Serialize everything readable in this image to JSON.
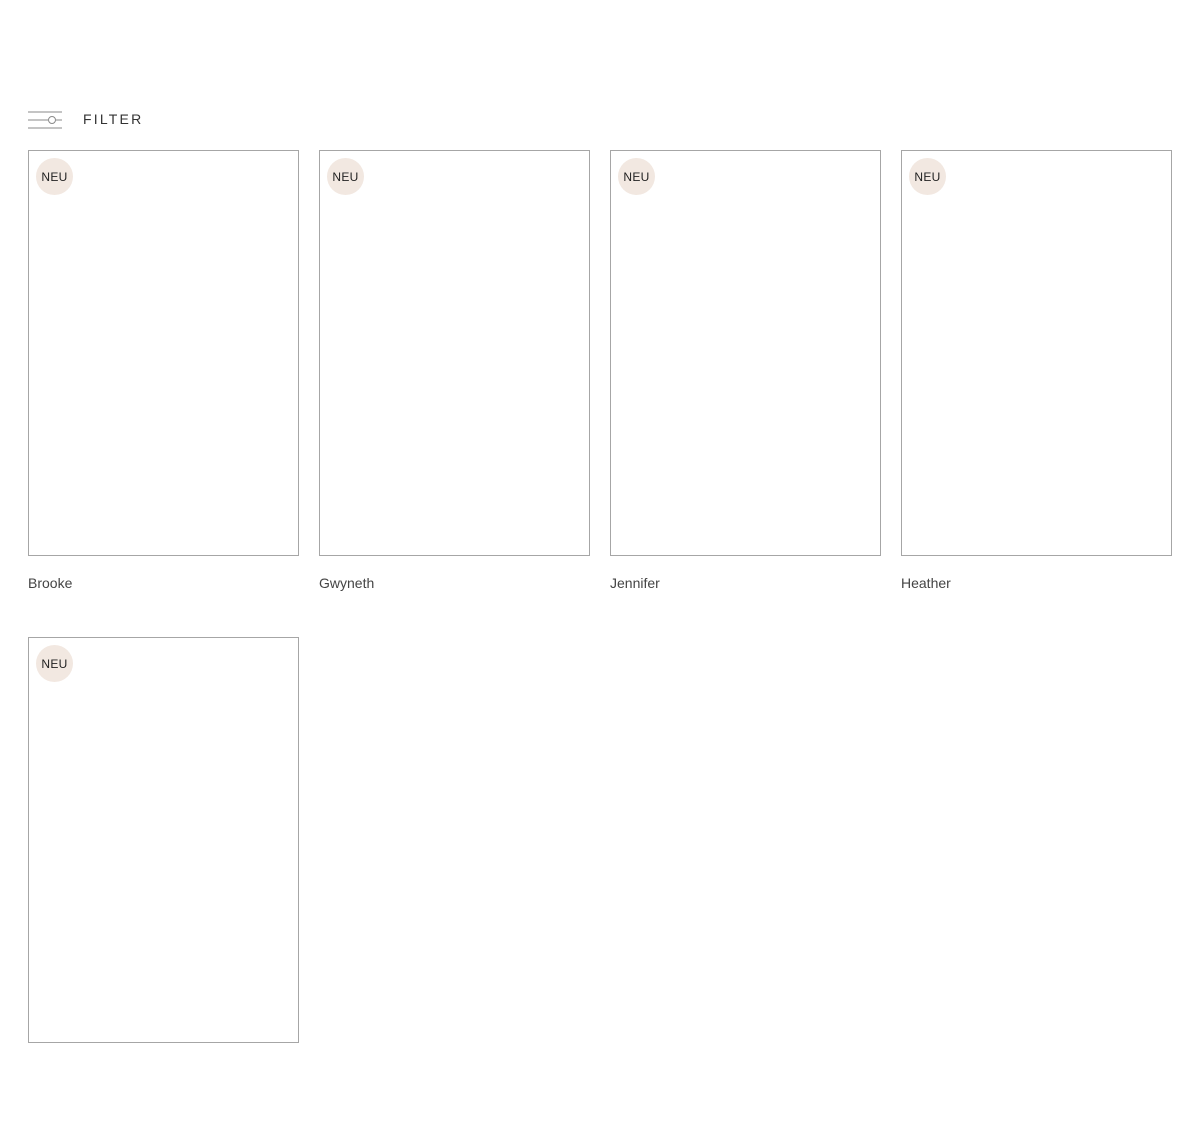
{
  "filter": {
    "label": "FILTER",
    "icon": "sliders-icon"
  },
  "badge_label": "NEU",
  "colors": {
    "badge_background": "#f2e8e1",
    "card_border": "#a6a6a6",
    "text": "#333333"
  },
  "products": [
    {
      "name": "Brooke",
      "badge": "NEU"
    },
    {
      "name": "Gwyneth",
      "badge": "NEU"
    },
    {
      "name": "Jennifer",
      "badge": "NEU"
    },
    {
      "name": "Heather",
      "badge": "NEU"
    },
    {
      "name": "",
      "badge": "NEU"
    }
  ]
}
